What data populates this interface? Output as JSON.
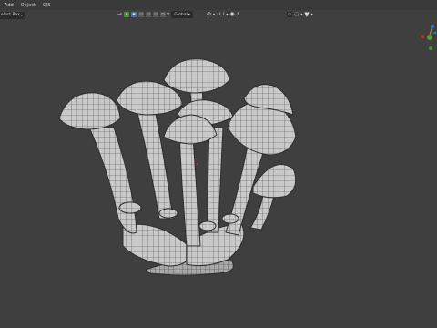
{
  "menubar": {
    "items": [
      "Add",
      "Object",
      "GIS"
    ]
  },
  "header": {
    "select_mode": "elect Box",
    "transform_orientation": "Global",
    "icons": {
      "select_box": "chevron-down-icon",
      "transform_pivot": "pivot-icon",
      "snap": "magnet-icon",
      "proportional": "proportional-edit-icon",
      "overlay": "overlay-icon",
      "filter": "filter-icon"
    }
  },
  "viewport": {
    "background": "#3f3f3f",
    "object": "mushroom cluster wireframe"
  }
}
